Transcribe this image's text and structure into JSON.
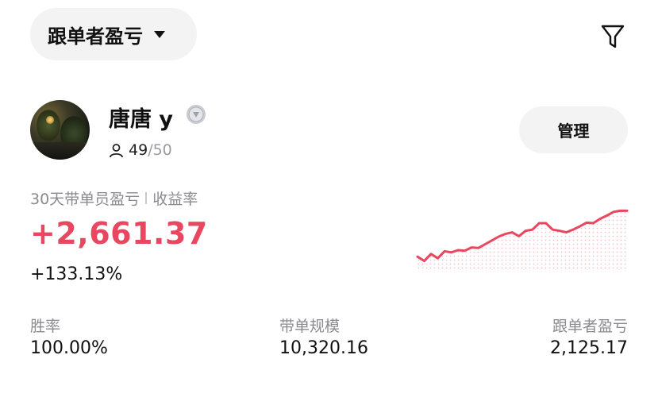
{
  "header": {
    "sort_label": "跟单者盈亏",
    "filter_icon": "filter-icon"
  },
  "trader": {
    "name": "唐唐 y",
    "followers_count": "49",
    "followers_max": "/50",
    "manage_label": "管理"
  },
  "pnl": {
    "period_label": "30天带单员盈亏",
    "rate_label": "收益率",
    "value": "+2,661.37",
    "rate": "+133.13%",
    "accent_color": "#e8475f"
  },
  "sparkline": {
    "trend": [
      0.1,
      0.02,
      0.15,
      0.07,
      0.2,
      0.18,
      0.22,
      0.21,
      0.27,
      0.26,
      0.33,
      0.4,
      0.47,
      0.52,
      0.55,
      0.48,
      0.58,
      0.6,
      0.72,
      0.72,
      0.6,
      0.58,
      0.55,
      0.6,
      0.66,
      0.73,
      0.72,
      0.8,
      0.86,
      0.93,
      0.95,
      0.95
    ]
  },
  "stats": [
    {
      "label": "胜率",
      "value": "100.00%"
    },
    {
      "label": "带单规模",
      "value": "10,320.16"
    },
    {
      "label": "跟单者盈亏",
      "value": "2,125.17"
    }
  ]
}
